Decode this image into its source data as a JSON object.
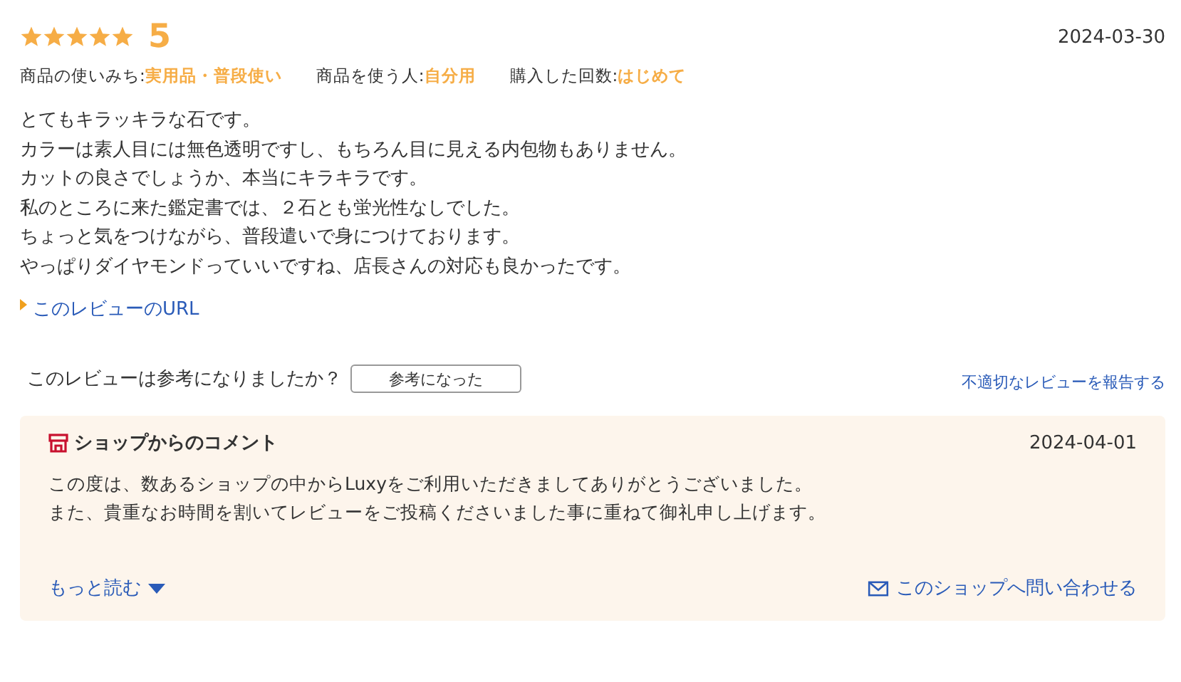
{
  "review": {
    "stars": 5,
    "rating": "5",
    "date": "2024-03-30",
    "attributes": [
      {
        "label": "商品の使いみち:",
        "value": "実用品・普段使い"
      },
      {
        "label": "商品を使う人:",
        "value": "自分用"
      },
      {
        "label": "購入した回数:",
        "value": "はじめて"
      }
    ],
    "body": [
      "とてもキラッキラな石です。",
      "カラーは素人目には無色透明ですし、もちろん目に見える内包物もありません。",
      "カットの良さでしょうか、本当にキラキラです。",
      "私のところに来た鑑定書では、２石とも蛍光性なしでした。",
      "ちょっと気をつけながら、普段遣いで身につけております。",
      "やっぱりダイヤモンドっていいですね、店長さんの対応も良かったです。"
    ],
    "url_link": "このレビューのURL"
  },
  "helpful": {
    "question": "このレビューは参考になりましたか？",
    "button": "参考になった",
    "report_link": "不適切なレビューを報告する"
  },
  "shop_comment": {
    "title": "ショップからのコメント",
    "date": "2024-04-01",
    "body": [
      "この度は、数あるショップの中からLuxyをご利用いただきましてありがとうございました。",
      "また、貴重なお時間を割いてレビューをご投稿くださいました事に重ねて御礼申し上げます。"
    ],
    "more_link": "もっと読む",
    "contact_link": "このショップへ問い合わせる"
  }
}
